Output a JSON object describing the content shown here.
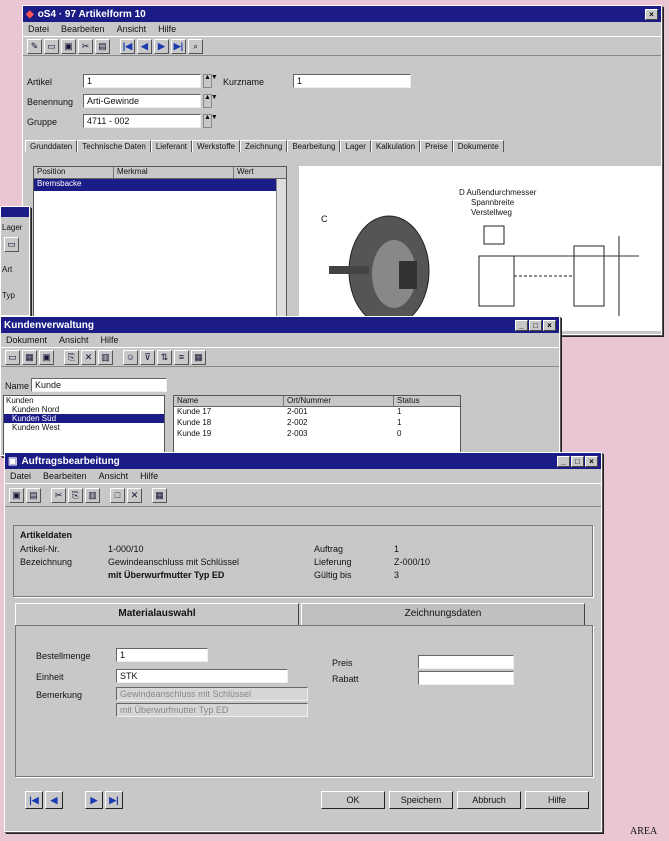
{
  "win1": {
    "title": "oS4 · 97 Artikelform 10",
    "menu": [
      "Datei",
      "Bearbeiten",
      "Ansicht",
      "Hilfe"
    ],
    "fields": {
      "artikel_label": "Artikel",
      "artikel_value": "1",
      "kurzname_label": "Kurzname",
      "kurzname_value": "1",
      "benennung_label": "Benennung",
      "benennung_value": "Arti-Gewinde",
      "gruppe_label": "Gruppe",
      "gruppe_value": "4711 - 002"
    },
    "tabs": [
      "Grunddaten",
      "Technische Daten",
      "Lieferant",
      "Werkstoffe",
      "Zeichnung",
      "Bearbeitung",
      "Lager",
      "Kalkulation",
      "Preise",
      "Dokumente"
    ],
    "list_headers": [
      "Position",
      "Merkmal",
      "Wert"
    ],
    "list_selected": "Bremsbacke",
    "drawing_legend": [
      "D  Außendurchmesser",
      "Spannbreite",
      "Verstellweg"
    ],
    "drawing_label_c": "C"
  },
  "win_left": {
    "labels": [
      "Lager",
      "Art",
      "Typ"
    ]
  },
  "win2": {
    "title": "Kundenverwaltung",
    "menu": [
      "Dokument",
      "Ansicht",
      "Hilfe"
    ],
    "search_label": "Name",
    "search_value": "Kunde",
    "tree": [
      "Kunden",
      "Kunden Nord",
      "Kunden Süd",
      "Kunden West"
    ],
    "grid_headers": [
      "Name",
      "Ort/Nummer",
      "Status"
    ],
    "grid_rows": [
      [
        "Kunde 17",
        "2-001",
        "1"
      ],
      [
        "Kunde 18",
        "2-002",
        "1"
      ],
      [
        "Kunde 19",
        "2-003",
        "0"
      ]
    ]
  },
  "win3": {
    "title": "Auftragsbearbeitung",
    "menu": [
      "Datei",
      "Bearbeiten",
      "Ansicht",
      "Hilfe"
    ],
    "section_title": "Artikeldaten",
    "artikel_label": "Artikel-Nr.",
    "artikel_value": "1-000/10",
    "bezeichnung_label": "Bezeichnung",
    "bezeichnung_line1": "Gewindeanschluss mit Schlüssel",
    "bezeichnung_line2": "mit Überwurfmutter Typ ED",
    "right_labels": [
      "Auftrag",
      "Lieferung",
      "Gültig bis"
    ],
    "right_values": [
      "1",
      "Z-000/10",
      "3"
    ],
    "page_tabs": [
      "Materialauswahl",
      "Zeichnungsdaten"
    ],
    "form": {
      "menge_label": "Bestellmenge",
      "menge_value": "1",
      "einheit_label": "Einheit",
      "einheit_value": "STK",
      "bemerkung_label": "Bemerkung",
      "bemerkung_line1": "Gewindeanschluss mit Schlüssel",
      "bemerkung_line2": "mit Überwurfmutter Typ ED",
      "preis_label": "Preis",
      "preis_value": "",
      "rabatt_label": "Rabatt",
      "rabatt_value": ""
    },
    "nav_buttons": [
      "|◀",
      "◀",
      "▶",
      "▶|"
    ],
    "buttons": [
      "OK",
      "Speichern",
      "Abbruch",
      "Hilfe"
    ]
  },
  "footer_text": "AREA",
  "colors": {
    "background": "#eac6d5",
    "titlebar": "#1c1c86",
    "window": "#c8c8c8"
  }
}
